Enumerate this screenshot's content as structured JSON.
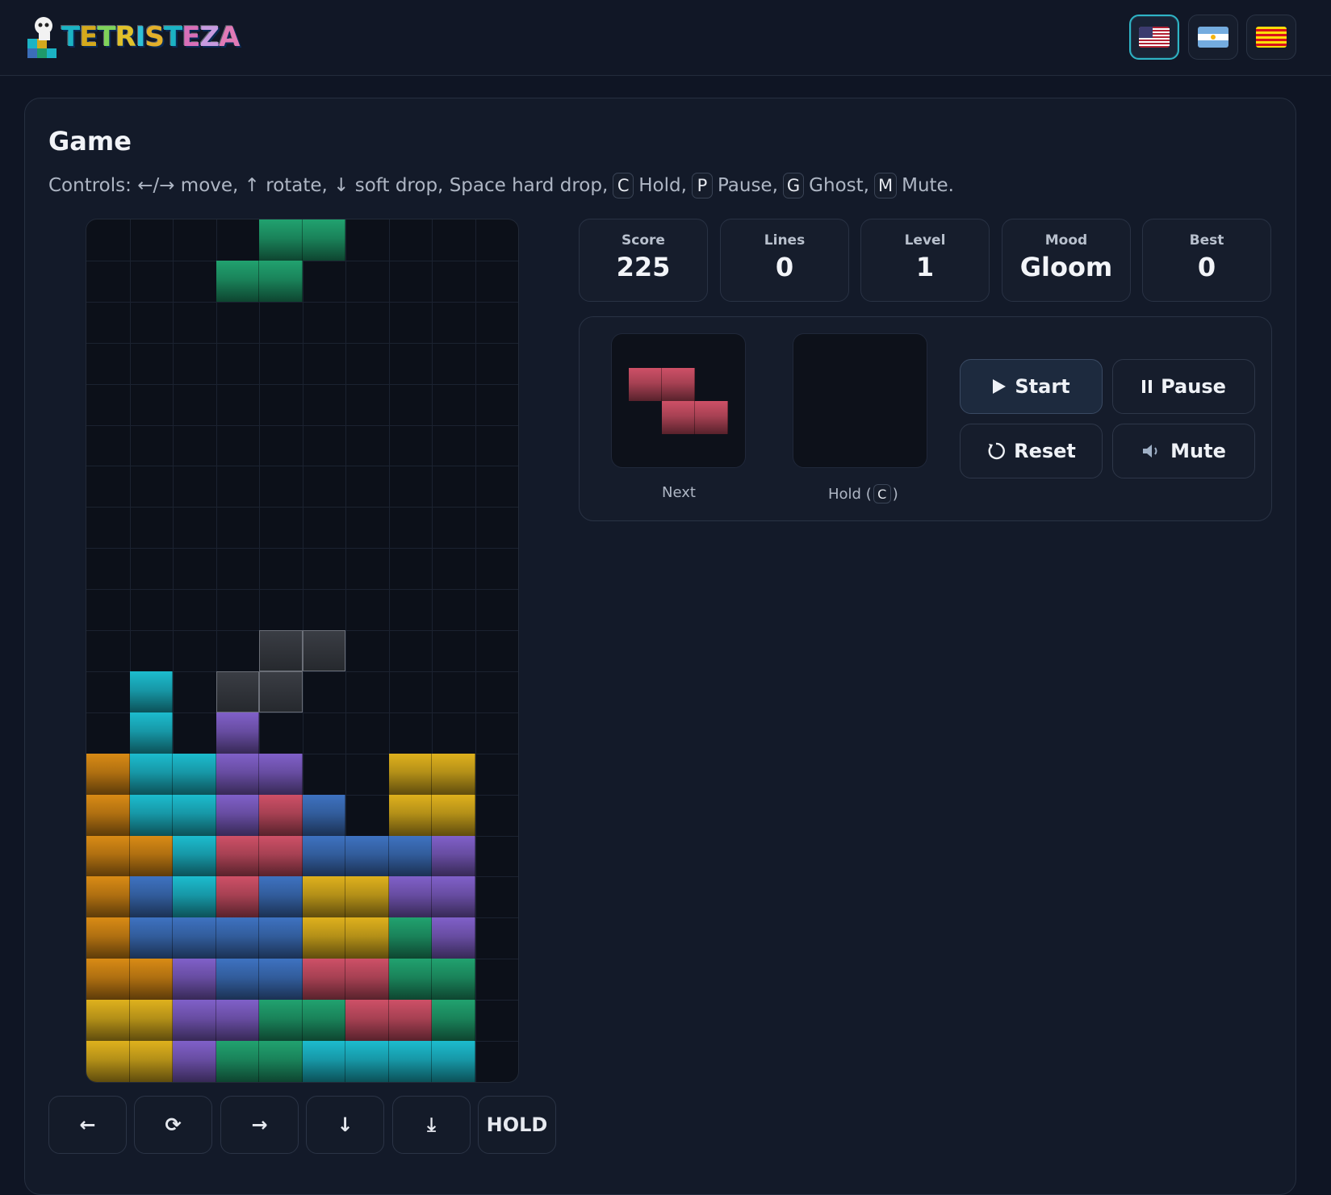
{
  "app": {
    "logo_text": "TETRISTEZA"
  },
  "languages": [
    {
      "code": "us",
      "active": true
    },
    {
      "code": "ar",
      "active": false
    },
    {
      "code": "cat",
      "active": false
    }
  ],
  "game": {
    "title": "Game",
    "controls": {
      "prefix": "Controls:",
      "move": "←/→ move,",
      "rotate": "↑ rotate,",
      "soft": "↓ soft drop,",
      "hard": "Space hard drop,",
      "hold_key": "C",
      "hold_text": "Hold,",
      "pause_key": "P",
      "pause_text": "Pause,",
      "ghost_key": "G",
      "ghost_text": "Ghost,",
      "mute_key": "M",
      "mute_text": "Mute."
    }
  },
  "stats": {
    "score": {
      "label": "Score",
      "value": "225"
    },
    "lines": {
      "label": "Lines",
      "value": "0"
    },
    "level": {
      "label": "Level",
      "value": "1"
    },
    "mood": {
      "label": "Mood",
      "value": "Gloom"
    },
    "best": {
      "label": "Best",
      "value": "0"
    }
  },
  "next": {
    "label": "Next",
    "piece": "Z"
  },
  "hold": {
    "label_prefix": "Hold (",
    "key": "C",
    "label_suffix": ")",
    "piece": null
  },
  "buttons": {
    "start": "Start",
    "pause": "Pause",
    "reset": "Reset",
    "mute": "Mute"
  },
  "touch_controls": {
    "left": "←",
    "rotate": "⟳",
    "right": "→",
    "down": "↓",
    "drop": "⤓",
    "hold": "HOLD"
  },
  "colors": {
    "I": "#1bb3c4",
    "O": "#d4a91c",
    "T": "#7a5bbf",
    "S": "#1f9a6a",
    "Z": "#c44c62",
    "J": "#3b6db8",
    "L": "#cf8414",
    "accent": "#2fb4c6"
  },
  "board": {
    "cols": 10,
    "rows": 20,
    "rows_data": [
      "....SS....",
      "...SS.....",
      "..........",
      "..........",
      "..........",
      "..........",
      "..........",
      "..........",
      "..........",
      "..........",
      "..........",
      ".I.G......",
      ".I.T......",
      "LIITT..OO.",
      "LIITZJ.OO.",
      "LLIZZJJJT.",
      "LJIZJOOTT.",
      "LJJJJOOST.",
      "LLTJJZZSS.",
      "OOTTSSZZS.",
      "OOTSSIIII."
    ],
    "ghost_cells": [
      [
        10,
        4
      ],
      [
        10,
        5
      ],
      [
        11,
        3
      ],
      [
        11,
        4
      ]
    ]
  }
}
